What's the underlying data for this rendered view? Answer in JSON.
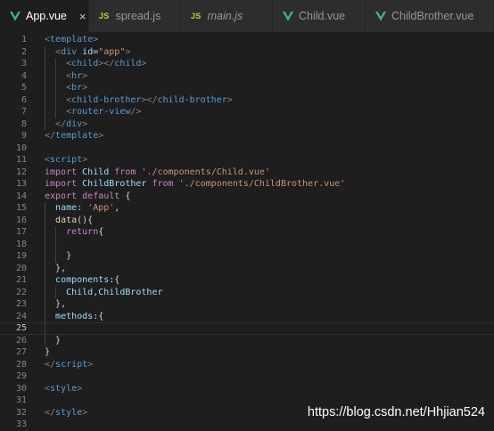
{
  "tabs": [
    {
      "label": "App.vue",
      "icon": "vue-icon",
      "active": true,
      "italic": false
    },
    {
      "label": "spread.js",
      "icon": "js-icon",
      "active": false,
      "italic": false
    },
    {
      "label": "main.js",
      "icon": "js-icon",
      "active": false,
      "italic": true
    },
    {
      "label": "Child.vue",
      "icon": "vue-icon",
      "active": false,
      "italic": false
    },
    {
      "label": "ChildBrother.vue",
      "icon": "vue-icon",
      "active": false,
      "italic": false
    }
  ],
  "js_icon_text": "JS",
  "close_glyph": "×",
  "current_line": 25,
  "code_lines": [
    [
      [
        "<",
        "br"
      ],
      [
        "template",
        "tag"
      ],
      [
        ">",
        "br"
      ]
    ],
    [
      [
        "  ",
        ""
      ],
      [
        "<",
        "br"
      ],
      [
        "div",
        "tag"
      ],
      [
        " ",
        ""
      ],
      [
        "id",
        "attr"
      ],
      [
        "=",
        "punc"
      ],
      [
        "\"app\"",
        "str"
      ],
      [
        ">",
        "br"
      ]
    ],
    [
      [
        "    ",
        ""
      ],
      [
        "<",
        "br"
      ],
      [
        "child",
        "tag"
      ],
      [
        "></",
        "br"
      ],
      [
        "child",
        "tag"
      ],
      [
        ">",
        "br"
      ]
    ],
    [
      [
        "    ",
        ""
      ],
      [
        "<",
        "br"
      ],
      [
        "hr",
        "tag"
      ],
      [
        ">",
        "br"
      ]
    ],
    [
      [
        "    ",
        ""
      ],
      [
        "<",
        "br"
      ],
      [
        "br",
        "tag"
      ],
      [
        ">",
        "br"
      ]
    ],
    [
      [
        "    ",
        ""
      ],
      [
        "<",
        "br"
      ],
      [
        "child-brother",
        "tag"
      ],
      [
        "></",
        "br"
      ],
      [
        "child-brother",
        "tag"
      ],
      [
        ">",
        "br"
      ]
    ],
    [
      [
        "    ",
        ""
      ],
      [
        "<",
        "br"
      ],
      [
        "router-view",
        "tag"
      ],
      [
        "/>",
        "br"
      ]
    ],
    [
      [
        "  ",
        ""
      ],
      [
        "</",
        "br"
      ],
      [
        "div",
        "tag"
      ],
      [
        ">",
        "br"
      ]
    ],
    [
      [
        "</",
        "br"
      ],
      [
        "template",
        "tag"
      ],
      [
        ">",
        "br"
      ]
    ],
    [],
    [
      [
        "<",
        "br"
      ],
      [
        "script",
        "tag"
      ],
      [
        ">",
        "br"
      ]
    ],
    [
      [
        "import",
        "key"
      ],
      [
        " ",
        ""
      ],
      [
        "Child",
        "var"
      ],
      [
        " ",
        ""
      ],
      [
        "from",
        "key"
      ],
      [
        " ",
        ""
      ],
      [
        "'./components/Child.vue'",
        "str"
      ]
    ],
    [
      [
        "import",
        "key"
      ],
      [
        " ",
        ""
      ],
      [
        "ChildBrother",
        "var"
      ],
      [
        " ",
        ""
      ],
      [
        "from",
        "key"
      ],
      [
        " ",
        ""
      ],
      [
        "'./components/ChildBrother.vue'",
        "str"
      ]
    ],
    [
      [
        "export",
        "key"
      ],
      [
        " ",
        ""
      ],
      [
        "default",
        "key"
      ],
      [
        " {",
        "punc"
      ]
    ],
    [
      [
        "  ",
        ""
      ],
      [
        "name",
        "var"
      ],
      [
        ": ",
        "punc"
      ],
      [
        "'App'",
        "str"
      ],
      [
        ",",
        "punc"
      ]
    ],
    [
      [
        "  ",
        ""
      ],
      [
        "data",
        "fn"
      ],
      [
        "(){",
        "punc"
      ]
    ],
    [
      [
        "    ",
        ""
      ],
      [
        "return",
        "key"
      ],
      [
        "{",
        "punc"
      ]
    ],
    [],
    [
      [
        "    ",
        ""
      ],
      [
        "}",
        "punc"
      ]
    ],
    [
      [
        "  ",
        ""
      ],
      [
        "},",
        "punc"
      ]
    ],
    [
      [
        "  ",
        ""
      ],
      [
        "components",
        "var"
      ],
      [
        ":{",
        "punc"
      ]
    ],
    [
      [
        "    ",
        ""
      ],
      [
        "Child",
        "var"
      ],
      [
        ",",
        "punc"
      ],
      [
        "ChildBrother",
        "var"
      ]
    ],
    [
      [
        "  ",
        ""
      ],
      [
        "},",
        "punc"
      ]
    ],
    [
      [
        "  ",
        ""
      ],
      [
        "methods",
        "var"
      ],
      [
        ":{",
        "punc"
      ]
    ],
    [],
    [
      [
        "  ",
        ""
      ],
      [
        "}",
        "punc"
      ]
    ],
    [
      [
        "}",
        "punc"
      ]
    ],
    [
      [
        "</",
        "br"
      ],
      [
        "script",
        "tag"
      ],
      [
        ">",
        "br"
      ]
    ],
    [],
    [
      [
        "<",
        "br"
      ],
      [
        "style",
        "tag"
      ],
      [
        ">",
        "br"
      ]
    ],
    [],
    [
      [
        "</",
        "br"
      ],
      [
        "style",
        "tag"
      ],
      [
        ">",
        "br"
      ]
    ],
    []
  ],
  "watermark": "https://blog.csdn.net/Hhjian524",
  "colors": {
    "editor_bg": "#1e1e1e",
    "tabbar_bg": "#252526",
    "tab_inactive_bg": "#2d2d2d",
    "vue_green": "#41b883",
    "js_yellow": "#cbcb41"
  }
}
